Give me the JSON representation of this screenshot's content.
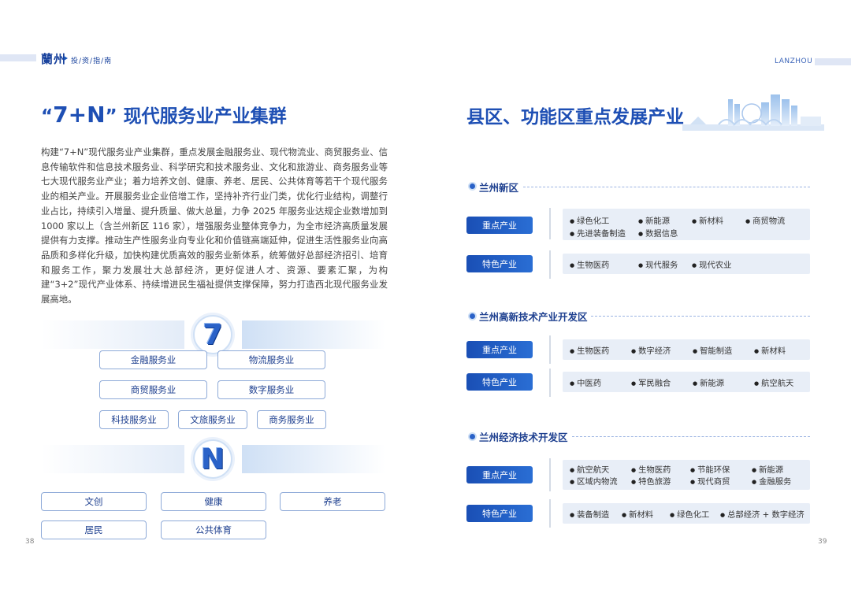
{
  "header": {
    "brand": "蘭州",
    "brand_sub": "投/资/指/南",
    "lanzhou": "LANZHOU"
  },
  "left": {
    "title_quote_open": "“",
    "title_num": "7+N",
    "title_quote_close": "”",
    "title_rest": "现代服务业产业集群",
    "paragraph": "构建“7+N”现代服务业产业集群，重点发展金融服务业、现代物流业、商贸服务业、信息传输软件和信息技术服务业、科学研究和技术服务业、文化和旅游业、商务服务业等七大现代服务业产业；着力培养文创、健康、养老、居民、公共体育等若干个现代服务业的相关产业。开展服务业企业倍增工作，坚持补齐行业门类，优化行业结构，调整行业占比，持续引入增量、提升质量、做大总量，力争 2025 年服务业达规企业数增加到 1000 家以上（含兰州新区 116 家），增强服务业整体竞争力，为全市经济高质量发展提供有力支撑。推动生产性服务业向专业化和价值链高端延伸，促进生活性服务业向高品质和多样化升级，加快构建优质高效的服务业新体系，统筹做好总部经济招引、培育和服务工作，聚力发展壮大总部经济，更好促进人才、资源、要素汇聚，为构建“3+2”现代产业体系、持续增进民生福祉提供支撑保障，努力打造西北现代服务业发展高地。",
    "seven_label": "7",
    "seven_items": [
      "金融服务业",
      "物流服务业",
      "商贸服务业",
      "数字服务业",
      "科技服务业",
      "文旅服务业",
      "商务服务业"
    ],
    "n_label": "N",
    "n_items": [
      "文创",
      "健康",
      "养老",
      "居民",
      "公共体育"
    ],
    "page_number": "38"
  },
  "right": {
    "title": "县区、功能区重点发展产业",
    "page_number": "39",
    "sections": [
      {
        "name": "兰州新区",
        "rows": [
          {
            "tag": "重点产业",
            "items": [
              "绿色化工",
              "新能源",
              "新材料",
              "商贸物流",
              "先进装备制造",
              "数据信息"
            ]
          },
          {
            "tag": "特色产业",
            "items": [
              "生物医药",
              "现代服务",
              "现代农业"
            ]
          }
        ]
      },
      {
        "name": "兰州高新技术产业开发区",
        "rows": [
          {
            "tag": "重点产业",
            "items": [
              "生物医药",
              "数字经济",
              "智能制造",
              "新材料"
            ]
          },
          {
            "tag": "特色产业",
            "items": [
              "中医药",
              "军民融合",
              "新能源",
              "航空航天"
            ]
          }
        ]
      },
      {
        "name": "兰州经济技术开发区",
        "rows": [
          {
            "tag": "重点产业",
            "items": [
              "航空航天",
              "生物医药",
              "节能环保",
              "新能源",
              "区域内物流",
              "特色旅游",
              "现代商贸",
              "金融服务"
            ]
          },
          {
            "tag": "特色产业",
            "items": [
              "装备制造",
              "新材料",
              "绿色化工",
              "总部经济 + 数字经济"
            ]
          }
        ]
      }
    ]
  }
}
